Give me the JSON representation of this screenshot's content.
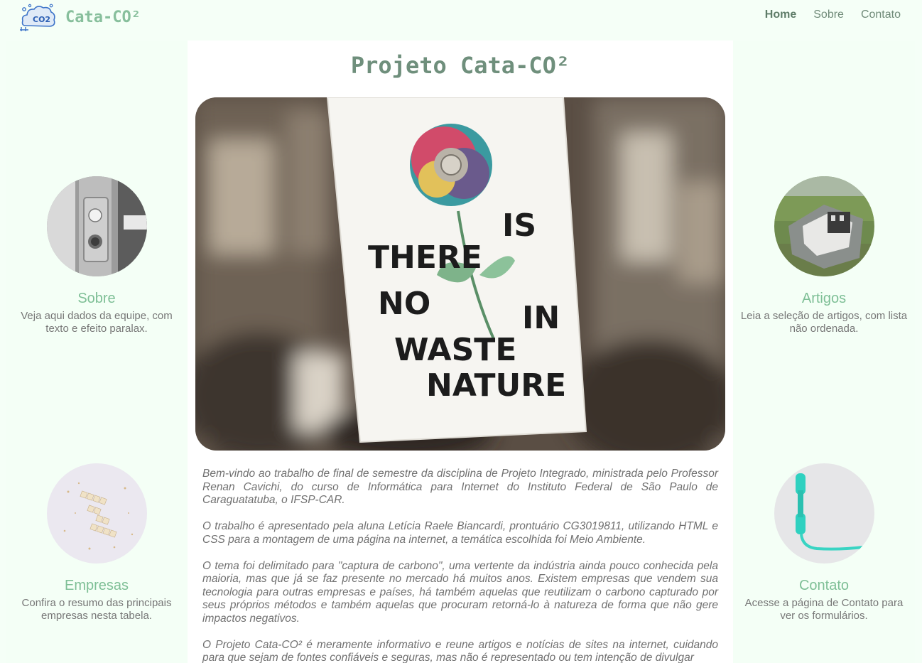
{
  "header": {
    "brand": "Cata-CO²",
    "logo_icon": "co2-cloud-logo-icon",
    "nav": [
      {
        "label": "Home",
        "active": true
      },
      {
        "label": "Sobre",
        "active": false
      },
      {
        "label": "Contato",
        "active": false
      }
    ]
  },
  "main": {
    "title": "Projeto Cata-CO²",
    "hero_sign_words": [
      "THERE",
      "IS",
      "NO",
      "WASTE",
      "IN",
      "NATURE"
    ],
    "paragraphs": [
      "Bem-vindo ao trabalho de final de semestre da disciplina de Projeto Integrado, ministrada pelo Professor Renan Cavichi, do curso de Informática para Internet do Instituto Federal de São Paulo de Caraguatatuba, o IFSP-CAR.",
      "O trabalho é apresentado pela aluna Letícia Raele Biancardi, prontuário CG3019811, utilizando HTML e CSS para a montagem de uma página na internet, a temática escolhida foi Meio Ambiente.",
      "O tema foi delimitado para \"captura de carbono\", uma vertente da indústria ainda pouco conhecida pela maioria, mas que já se faz presente no mercado há muitos anos. Existem empresas que vendem sua tecnologia para outras empresas e países, há também aquelas que reutilizam o carbono capturado por seus próprios métodos e também aquelas que procuram retorná-lo à natureza de forma que não gere impactos negativos.",
      "O Projeto Cata-CO² é meramente informativo e reune artigos e notícias de sites na internet, cuidando para que sejam de fontes confiáveis e seguras, mas não é representado ou tem intenção de divulgar"
    ]
  },
  "cards": {
    "sobre": {
      "title": "Sobre",
      "text": "Veja aqui dados da equipe, com texto e efeito paralax."
    },
    "empresas": {
      "title": "Empresas",
      "text": "Confira o resumo das principais empresas nesta tabela."
    },
    "artigos": {
      "title": "Artigos",
      "text": "Leia a seleção de artigos, com lista não ordenada."
    },
    "contato": {
      "title": "Contato",
      "text": "Acesse a página de Contato para ver os formulários."
    }
  },
  "colors": {
    "accent": "#7ebf96",
    "title": "#6f8f7c",
    "background": "#f5fff7"
  }
}
